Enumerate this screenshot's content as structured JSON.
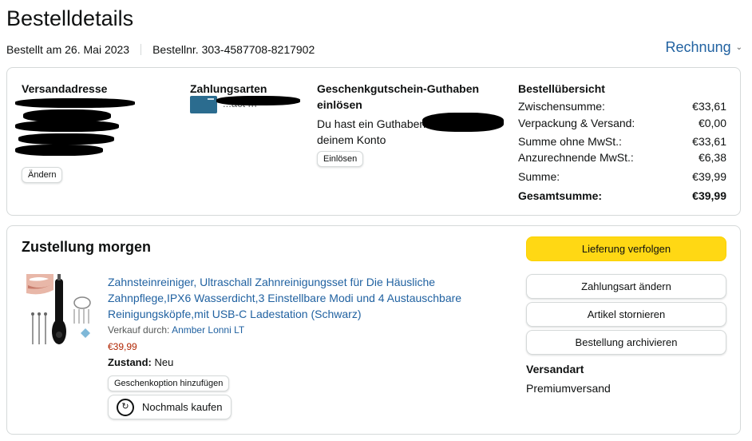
{
  "header": {
    "title": "Bestelldetails",
    "ordered_on": "Bestellt am 26. Mai 2023",
    "order_number": "Bestellnr. 303-4587708-8217902",
    "invoice_label": "Rechnung",
    "invoice_icon": "chevron-down-icon"
  },
  "shipping_address": {
    "heading": "Versandadresse",
    "change_label": "Ändern"
  },
  "payment": {
    "heading": "Zahlungsarten",
    "card_text_fragment": "...act m",
    "card_icon": "credit-card-icon",
    "card_color": "#2b6c8f"
  },
  "gift_card": {
    "heading": "Geschenkgutschein-Guthaben einlösen",
    "text_part1": "Du hast ein Guthaben",
    "text_part2": "deinem Konto",
    "redeem_label": "Einlösen"
  },
  "summary": {
    "heading": "Bestellübersicht",
    "rows": [
      {
        "label": "Zwischensumme:",
        "value": "€33,61"
      },
      {
        "label": "Verpackung & Versand:",
        "value": "€0,00"
      },
      {
        "label": "Summe ohne MwSt.:",
        "value": "€33,61"
      },
      {
        "label": "Anzurechnende MwSt.:",
        "value": "€6,38"
      },
      {
        "label": "Summe:",
        "value": "€39,99"
      },
      {
        "label": "Gesamtsumme:",
        "value": "€39,99"
      }
    ]
  },
  "delivery": {
    "title": "Zustellung morgen",
    "product": {
      "title": "Zahnsteinreiniger, Ultraschall Zahnreinigungsset für Die Häusliche Zahnpflege,IPX6 Wasserdicht,3 Einstellbare Modi und 4 Austauschbare Reinigungsköpfe,mit USB-C Ladestation (Schwarz)",
      "seller_prefix": "Verkauf durch:",
      "seller_name": "Anmber Lonni LT",
      "price": "€39,99",
      "condition_label": "Zustand:",
      "condition_value": "Neu",
      "gift_option_label": "Geschenkoption hinzufügen",
      "buy_again_label": "Nochmals kaufen",
      "buy_again_icon": "buy-again-icon"
    },
    "actions": {
      "track": "Lieferung verfolgen",
      "change_payment": "Zahlungsart ändern",
      "cancel": "Artikel stornieren",
      "archive": "Bestellung archivieren"
    },
    "shipping_method_label": "Versandart",
    "shipping_method_value": "Premiumversand"
  },
  "colors": {
    "link": "#2162a1",
    "price": "#b12704",
    "primary_button": "#ffd814",
    "border": "#d5d9d9"
  }
}
